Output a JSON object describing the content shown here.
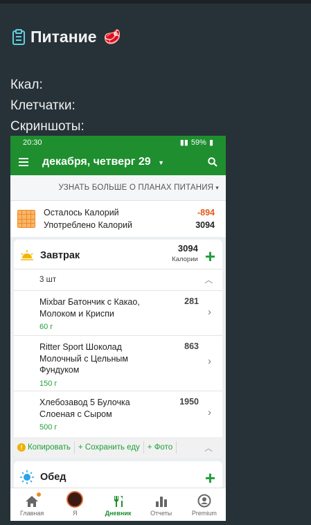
{
  "note": {
    "title": "Питание",
    "fields": [
      "Ккал:",
      "Клетчатки:",
      "Скриншоты:"
    ]
  },
  "status_bar": {
    "time": "20:30",
    "battery": "59%"
  },
  "app_bar": {
    "title": "декабря, четверг 29"
  },
  "plans_link": "УЗНАТЬ БОЛЬШЕ О ПЛАНАХ ПИТАНИЯ",
  "summary": {
    "remaining_label": "Осталось Калорий",
    "remaining_value": "-894",
    "consumed_label": "Употреблено Калорий",
    "consumed_value": "3094"
  },
  "breakfast": {
    "name": "Завтрак",
    "kcal": "3094",
    "kcal_unit": "Калории",
    "count": "3 шт",
    "items": [
      {
        "name": "Mixbar Батончик с Какао, Молоком и Криспи",
        "weight": "60 г",
        "kcal": "281"
      },
      {
        "name": "Ritter Sport Шоколад Молочный с Цельным Фундуком",
        "weight": "150 г",
        "kcal": "863"
      },
      {
        "name": "Хлебозавод 5 Булочка Слоеная с Сыром",
        "weight": "500 г",
        "kcal": "1950"
      }
    ],
    "actions": {
      "copy": "Копировать",
      "save": "+ Сохранить еду",
      "photo": "+ Фото"
    }
  },
  "lunch": {
    "name": "Обед"
  },
  "bottom_nav": [
    "Главная",
    "Я",
    "Дневник",
    "Отчеты",
    "Premium"
  ],
  "colors": {
    "primary": "#1e8e2e",
    "accent_green": "#1e9e3a",
    "negative": "#e05a1e",
    "background": "#263238"
  }
}
